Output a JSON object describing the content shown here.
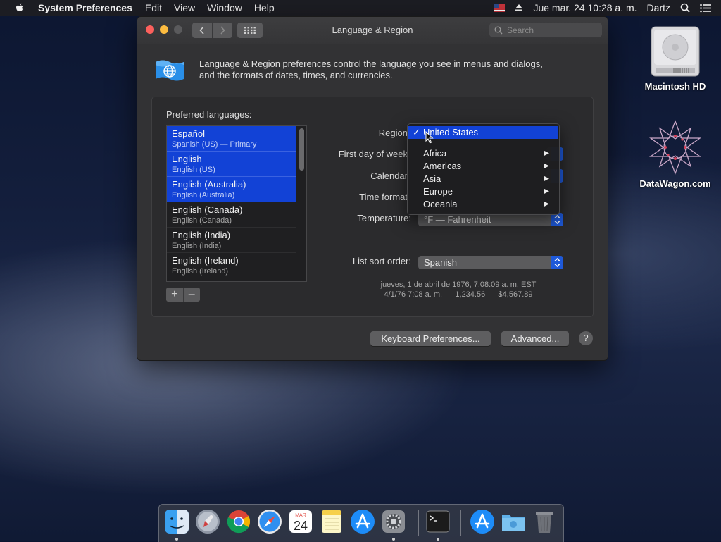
{
  "menubar": {
    "app_name": "System Preferences",
    "items": [
      "Edit",
      "View",
      "Window",
      "Help"
    ],
    "datetime": "Jue mar. 24  10:28 a. m.",
    "user": "Dartz"
  },
  "desktop": {
    "hd_label": "Macintosh HD",
    "dw_label": "DataWagon.com"
  },
  "window": {
    "title": "Language & Region",
    "search_placeholder": "Search",
    "intro_line1": "Language & Region preferences control the language you see in menus and dialogs,",
    "intro_line2": "and the formats of dates, times, and currencies.",
    "preferred_label": "Preferred languages:",
    "languages": [
      {
        "name": "Español",
        "sub": "Spanish (US) — Primary",
        "selected": true
      },
      {
        "name": "English",
        "sub": "English (US)",
        "selected": true
      },
      {
        "name": "English (Australia)",
        "sub": "English (Australia)",
        "selected": true
      },
      {
        "name": "English (Canada)",
        "sub": "English (Canada)",
        "selected": false
      },
      {
        "name": "English (India)",
        "sub": "English (India)",
        "selected": false
      },
      {
        "name": "English (Ireland)",
        "sub": "English (Ireland)",
        "selected": false
      }
    ],
    "add_label": "+",
    "remove_label": "–",
    "labels": {
      "region": "Region",
      "first_day": "First day of week",
      "calendar": "Calendar",
      "time_format": "Time format",
      "temperature": "Temperature:",
      "list_sort": "List sort order:"
    },
    "temperature_value": "°F — Fahrenheit",
    "list_sort_value": "Spanish",
    "sample_line1": "jueves, 1 de abril de 1976, 7:08:09 a. m. EST",
    "sample_line2": "4/1/76 7:08 a. m.      1,234.56      $4,567.89",
    "keyboard_button": "Keyboard Preferences...",
    "advanced_button": "Advanced...",
    "help_button": "?"
  },
  "region_menu": {
    "selected": "United States",
    "check": "✓",
    "items": [
      "Africa",
      "Americas",
      "Asia",
      "Europe",
      "Oceania"
    ],
    "submenu_arrow": "▶"
  },
  "dock": {
    "calendar_month": "MAR",
    "calendar_day": "24"
  },
  "colors": {
    "selection": "#1242d6",
    "popup_arrow": "#1e59d9"
  }
}
